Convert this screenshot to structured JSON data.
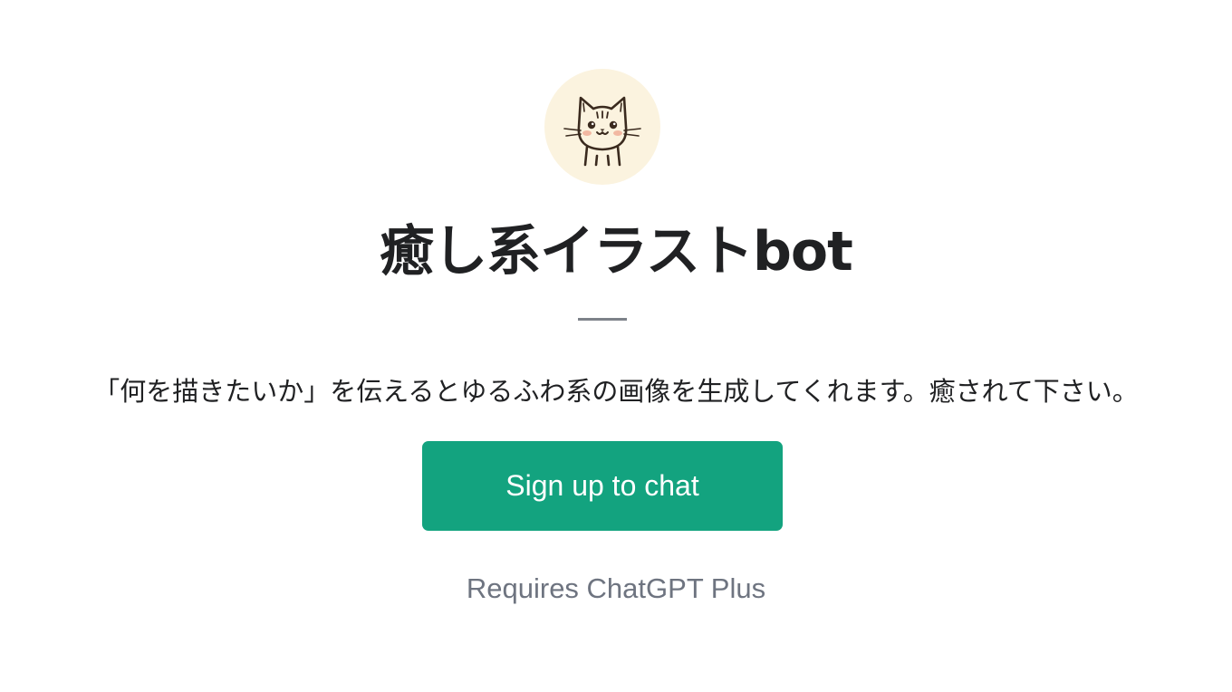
{
  "gpt": {
    "icon": "cat-illustration-icon",
    "name": "癒し系イラストbot",
    "description": "「何を描きたいか」を伝えるとゆるふわ系の画像を生成してくれます。癒されて下さい。"
  },
  "cta": {
    "label": "Sign up to chat"
  },
  "requirement": {
    "text": "Requires ChatGPT Plus"
  },
  "colors": {
    "accent": "#13a37f",
    "avatar_bg": "#fbf3df",
    "text": "#202123",
    "muted": "#6e7480"
  }
}
